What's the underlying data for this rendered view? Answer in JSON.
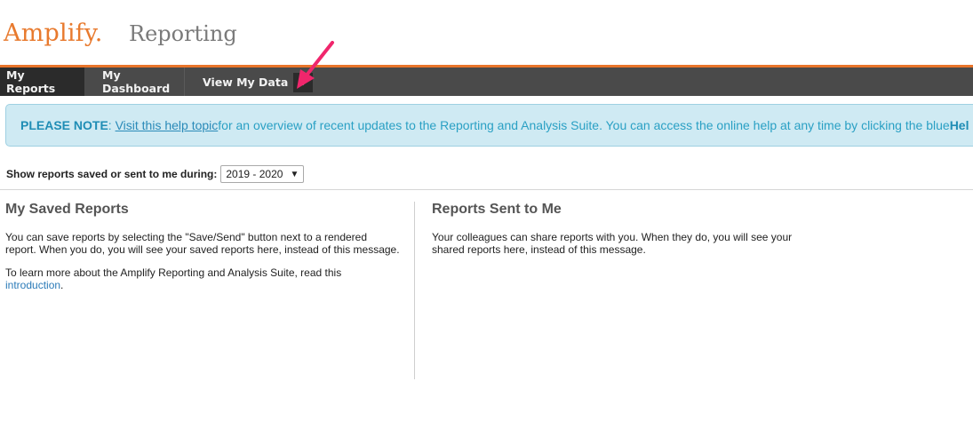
{
  "header": {
    "logo_text": "Amplify",
    "logo_dot": ".",
    "app_name": "Reporting"
  },
  "nav": {
    "items": [
      {
        "label": "My Reports"
      },
      {
        "label": "My Dashboard"
      },
      {
        "label": "View My Data"
      }
    ]
  },
  "note": {
    "prefix": "PLEASE NOTE",
    "colon": ":",
    "link": "Visit this help topic",
    "text": " for an overview of recent updates to the Reporting and Analysis Suite. You can access the online help at any time by clicking the blue ",
    "trailing": "Hel"
  },
  "filter": {
    "label": "Show reports saved or sent to me during:",
    "selected": "2019 - 2020"
  },
  "saved": {
    "title": "My Saved Reports",
    "para1_line1": "You can save reports by selecting the \"Save/Send\" button next to a rendered",
    "para1_line2": "report. When you do, you will see your saved reports here, instead of this message.",
    "para2_line1": "To learn more about the Amplify Reporting and Analysis Suite, read this",
    "para2_link": "introduction",
    "para2_end": "."
  },
  "sent": {
    "title": "Reports Sent to Me",
    "para_line1": "Your colleagues can share reports with you. When they do, you will see your",
    "para_line2": "shared reports here, instead of this message."
  },
  "colors": {
    "brand_orange": "#e87a2e",
    "nav_bg": "#4a4a4a",
    "note_bg": "#cfeaf3",
    "annotation_arrow": "#f0266c"
  }
}
